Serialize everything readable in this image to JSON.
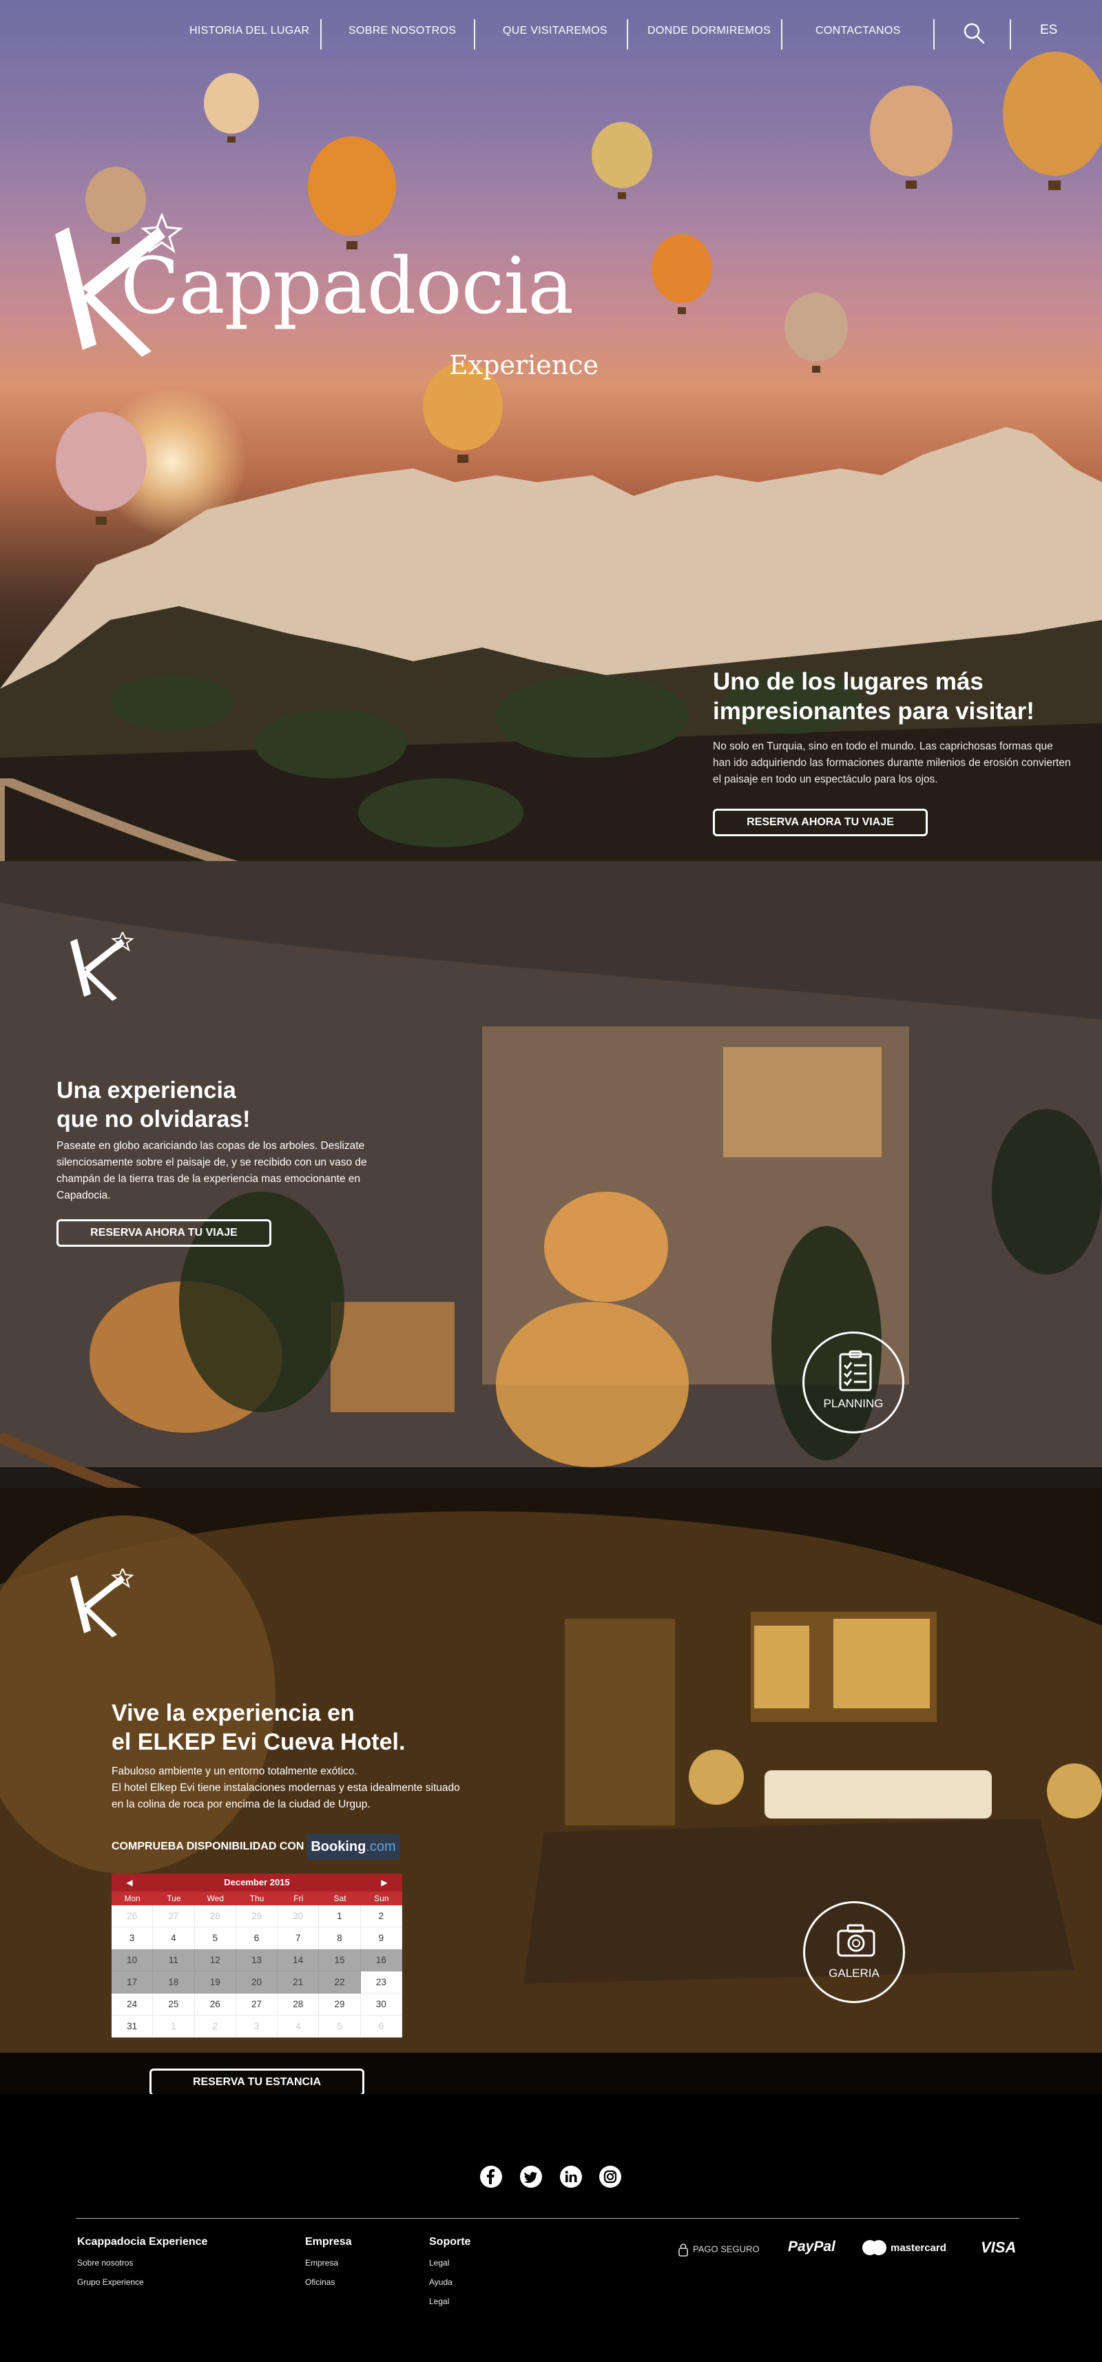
{
  "nav": {
    "items": [
      {
        "label": "HISTORIA DEL LUGAR"
      },
      {
        "label": "SOBRE NOSOTROS"
      },
      {
        "label": "QUE VISITAREMOS"
      },
      {
        "label": "DONDE DORMIREMOS"
      },
      {
        "label": "CONTACTANOS"
      }
    ],
    "search_icon": "search-icon",
    "language": "ES"
  },
  "brand": {
    "name": "Cappadocia",
    "subtitle": "Experience"
  },
  "hero": {
    "title": "Uno de los lugares más impresionantes para visitar!",
    "body": "No solo en Turquia, sino en todo el mundo. Las caprichosas formas que han ido adquiriendo las formaciones durante milenios de erosión convierten el paisaje en todo un espectáculo para los ojos.",
    "cta": "RESERVA AHORA TU VIAJE"
  },
  "experience": {
    "title_line1": "Una experiencia",
    "title_line2": "que no olvidaras!",
    "body": "Paseate en globo acariciando las copas de los arboles. Deslizate silenciosamente sobre el paisaje de, y se recibido con un vaso de champán de la tierra tras de la experiencia mas emocionante en Capadocia.",
    "cta": "RESERVA AHORA TU VIAJE",
    "badge": "PLANNING",
    "badge_icon": "checklist-icon"
  },
  "hotel": {
    "title_line1": "Vive la experiencia en",
    "title_line2": "el ELKEP Evi Cueva Hotel.",
    "body_line1": "Fabuloso ambiente y un entorno totalmente exótico.",
    "body_line2": "El hotel Elkep Evi tiene instalaciones modernas y esta idealmente situado en la colina de roca por encima de la ciudad de Urgup.",
    "availability": "COMPRUEBA DISPONIBILIDAD CON",
    "booking_a": "Booking",
    "booking_b": ".com",
    "cta": "RESERVA TU ESTANCIA",
    "badge": "GALERIA",
    "badge_icon": "camera-icon"
  },
  "calendar": {
    "month": "December 2015",
    "prev": "◀",
    "next": "▶",
    "weekdays": [
      "Mon",
      "Tue",
      "Wed",
      "Thu",
      "Fri",
      "Sat",
      "Sun"
    ],
    "days": [
      {
        "n": "26",
        "state": "muted"
      },
      {
        "n": "27",
        "state": "muted"
      },
      {
        "n": "28",
        "state": "muted"
      },
      {
        "n": "29",
        "state": "muted"
      },
      {
        "n": "30",
        "state": "muted"
      },
      {
        "n": "1",
        "state": ""
      },
      {
        "n": "2",
        "state": ""
      },
      {
        "n": "3",
        "state": ""
      },
      {
        "n": "4",
        "state": ""
      },
      {
        "n": "5",
        "state": ""
      },
      {
        "n": "6",
        "state": ""
      },
      {
        "n": "7",
        "state": ""
      },
      {
        "n": "8",
        "state": ""
      },
      {
        "n": "9",
        "state": ""
      },
      {
        "n": "10",
        "state": "sel"
      },
      {
        "n": "11",
        "state": "sel"
      },
      {
        "n": "12",
        "state": "sel"
      },
      {
        "n": "13",
        "state": "sel"
      },
      {
        "n": "14",
        "state": "sel"
      },
      {
        "n": "15",
        "state": "sel"
      },
      {
        "n": "16",
        "state": "sel"
      },
      {
        "n": "17",
        "state": "sel"
      },
      {
        "n": "18",
        "state": "sel"
      },
      {
        "n": "19",
        "state": "sel"
      },
      {
        "n": "20",
        "state": "sel"
      },
      {
        "n": "21",
        "state": "sel"
      },
      {
        "n": "22",
        "state": "sel"
      },
      {
        "n": "23",
        "state": ""
      },
      {
        "n": "24",
        "state": ""
      },
      {
        "n": "25",
        "state": ""
      },
      {
        "n": "26",
        "state": ""
      },
      {
        "n": "27",
        "state": ""
      },
      {
        "n": "28",
        "state": ""
      },
      {
        "n": "29",
        "state": ""
      },
      {
        "n": "30",
        "state": ""
      },
      {
        "n": "31",
        "state": ""
      },
      {
        "n": "1",
        "state": "muted"
      },
      {
        "n": "2",
        "state": "muted"
      },
      {
        "n": "3",
        "state": "muted"
      },
      {
        "n": "4",
        "state": "muted"
      },
      {
        "n": "5",
        "state": "muted"
      },
      {
        "n": "6",
        "state": "muted"
      }
    ]
  },
  "footer": {
    "social": [
      "facebook-icon",
      "twitter-icon",
      "linkedin-icon",
      "instagram-icon"
    ],
    "col1": {
      "heading": "Kcappadocia Experience",
      "links": [
        "Sobre nosotros",
        "Grupo Experience"
      ]
    },
    "col2": {
      "heading": "Empresa",
      "links": [
        "Empresa",
        "Oficinas"
      ]
    },
    "col3": {
      "heading": "Soporte",
      "links": [
        "Legal",
        "Ayuda",
        "Legal"
      ]
    },
    "payments": {
      "secure": "PAGO SEGURO",
      "paypal": "PayPal",
      "mastercard": "mastercard",
      "visa": "VISA"
    }
  },
  "colors": {
    "accent_red": "#a82024",
    "booking_blue": "#2f3b4e",
    "wave_gold": "#a58668"
  }
}
